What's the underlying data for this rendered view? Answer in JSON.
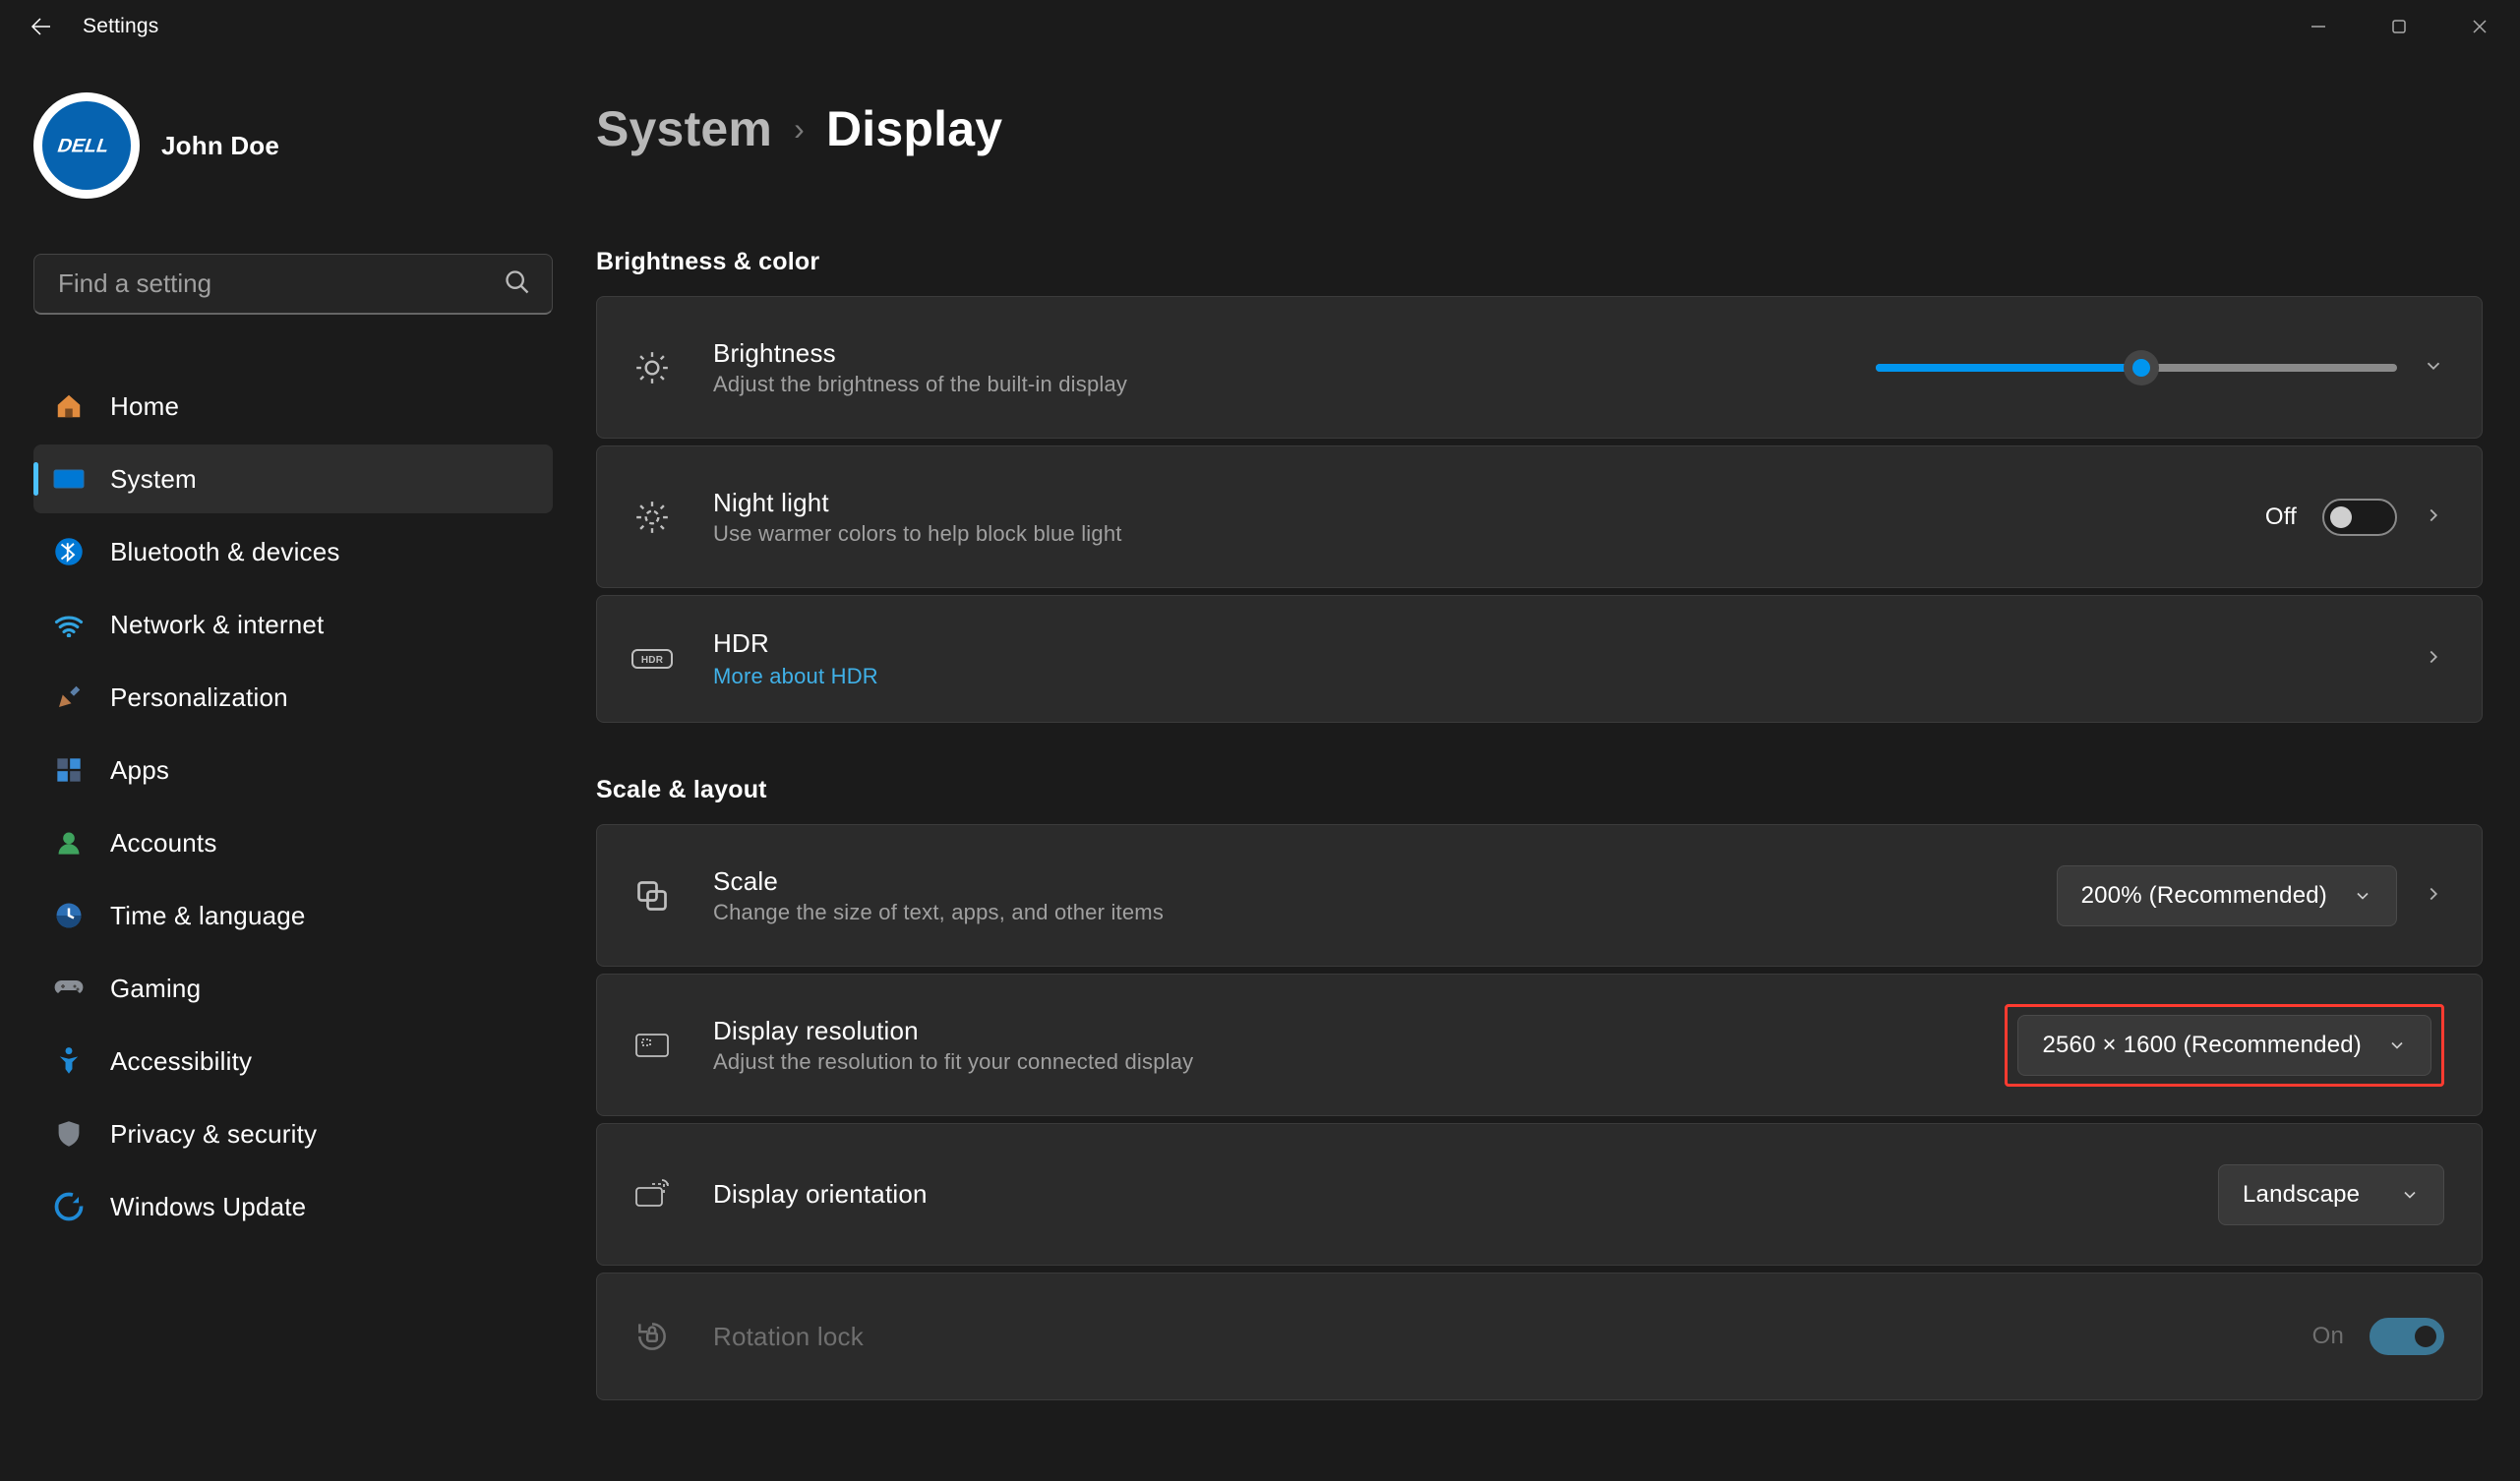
{
  "app_title": "Settings",
  "window_controls": {
    "minimize": "—",
    "maximize": "▢",
    "close": "✕"
  },
  "account": {
    "name": "John Doe",
    "avatar_brand": "DELL"
  },
  "search": {
    "placeholder": "Find a setting"
  },
  "sidebar": {
    "items": [
      {
        "id": "home",
        "label": "Home",
        "icon": "home-icon"
      },
      {
        "id": "system",
        "label": "System",
        "icon": "system-icon",
        "selected": true
      },
      {
        "id": "bluetooth",
        "label": "Bluetooth & devices",
        "icon": "bluetooth-icon"
      },
      {
        "id": "network",
        "label": "Network & internet",
        "icon": "network-icon"
      },
      {
        "id": "personalization",
        "label": "Personalization",
        "icon": "personalization-icon"
      },
      {
        "id": "apps",
        "label": "Apps",
        "icon": "apps-icon"
      },
      {
        "id": "accounts",
        "label": "Accounts",
        "icon": "accounts-icon"
      },
      {
        "id": "time",
        "label": "Time & language",
        "icon": "time-icon"
      },
      {
        "id": "gaming",
        "label": "Gaming",
        "icon": "gaming-icon"
      },
      {
        "id": "accessibility",
        "label": "Accessibility",
        "icon": "accessibility-icon"
      },
      {
        "id": "privacy",
        "label": "Privacy & security",
        "icon": "privacy-icon"
      },
      {
        "id": "update",
        "label": "Windows Update",
        "icon": "update-icon"
      }
    ]
  },
  "breadcrumb": {
    "level1": "System",
    "level2": "Display"
  },
  "sections": {
    "brightness_color": {
      "title": "Brightness & color",
      "brightness": {
        "title": "Brightness",
        "subtitle": "Adjust the brightness of the built-in display",
        "value_percent": 51
      },
      "night_light": {
        "title": "Night light",
        "subtitle": "Use warmer colors to help block blue light",
        "state_label": "Off",
        "state": false
      },
      "hdr": {
        "title": "HDR",
        "link": "More about HDR"
      }
    },
    "scale_layout": {
      "title": "Scale & layout",
      "scale": {
        "title": "Scale",
        "subtitle": "Change the size of text, apps, and other items",
        "value": "200% (Recommended)"
      },
      "resolution": {
        "title": "Display resolution",
        "subtitle": "Adjust the resolution to fit your connected display",
        "value": "2560 × 1600 (Recommended)",
        "highlighted": true
      },
      "orientation": {
        "title": "Display orientation",
        "value": "Landscape"
      },
      "rotation_lock": {
        "title": "Rotation lock",
        "state_label": "On",
        "state": true,
        "disabled": true
      }
    }
  },
  "colors": {
    "accent": "#0095ee",
    "link": "#40b1e8",
    "highlight": "#ff3b30"
  }
}
